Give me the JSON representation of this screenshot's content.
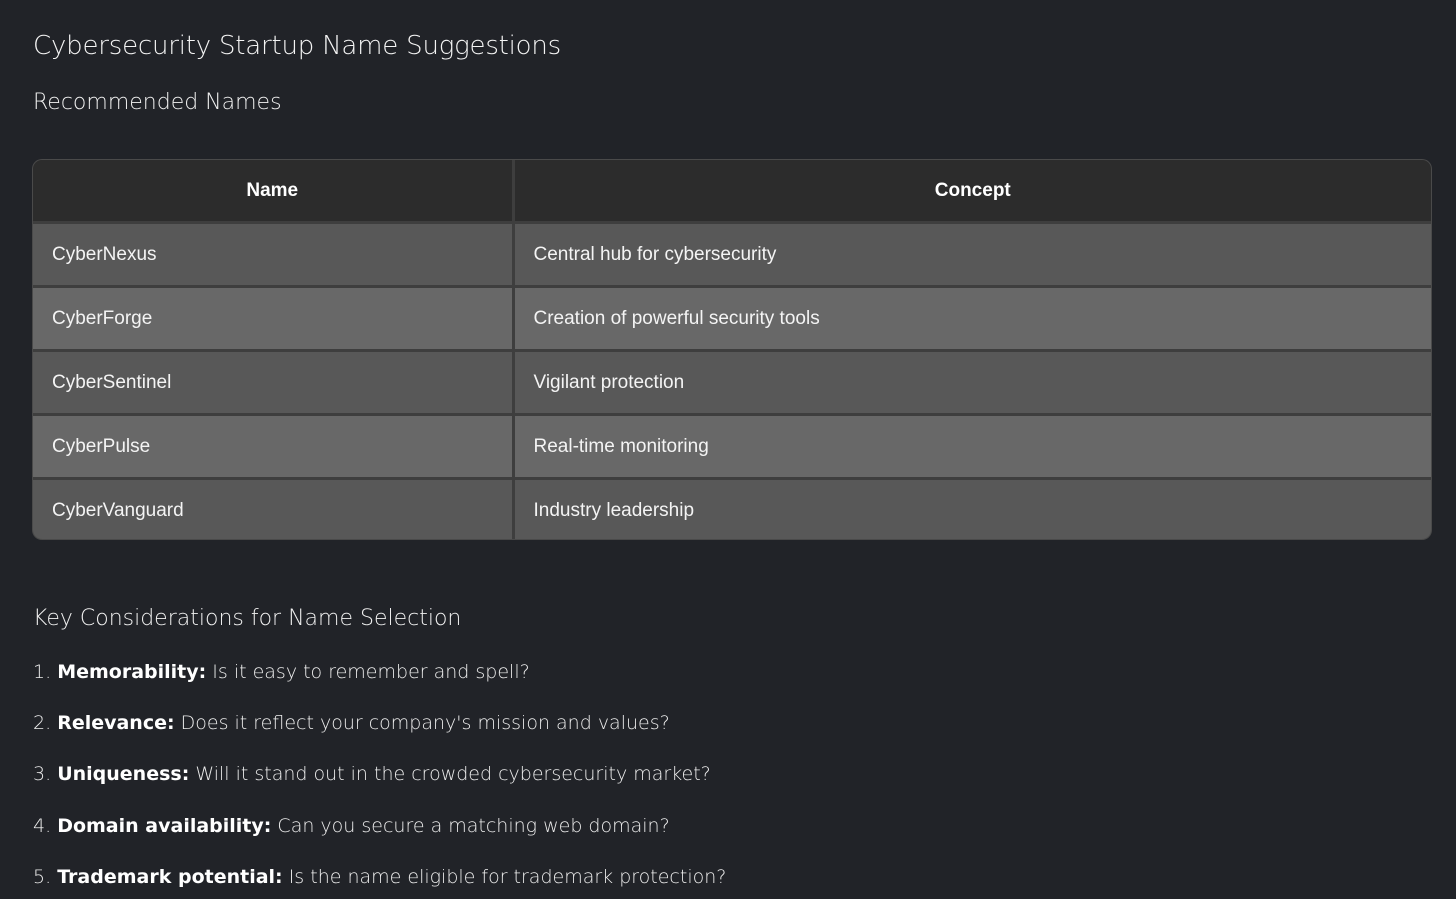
{
  "title": "Cybersecurity Startup Name Suggestions",
  "subtitle": "Recommended Names",
  "table": {
    "headers": [
      "Name",
      "Concept"
    ],
    "rows": [
      {
        "name": "CyberNexus",
        "concept": "Central hub for cybersecurity"
      },
      {
        "name": "CyberForge",
        "concept": "Creation of powerful security tools"
      },
      {
        "name": "CyberSentinel",
        "concept": "Vigilant protection"
      },
      {
        "name": "CyberPulse",
        "concept": "Real-time monitoring"
      },
      {
        "name": "CyberVanguard",
        "concept": "Industry leadership"
      }
    ]
  },
  "considerations": {
    "heading": "Key Considerations for Name Selection",
    "items": [
      {
        "number": "1.",
        "label": "Memorability:",
        "text": "Is it easy to remember and spell?"
      },
      {
        "number": "2.",
        "label": "Relevance:",
        "text": "Does it reflect your company's mission and values?"
      },
      {
        "number": "3.",
        "label": "Uniqueness:",
        "text": "Will it stand out in the crowded cybersecurity market?"
      },
      {
        "number": "4.",
        "label": "Domain availability:",
        "text": "Can you secure a matching web domain?"
      },
      {
        "number": "5.",
        "label": "Trademark potential:",
        "text": "Is the name eligible for trademark protection?"
      }
    ]
  },
  "colors": {
    "background": "#212328",
    "table_header": "#2c2c2c",
    "row_dark": "#585858",
    "row_light": "#686868"
  }
}
